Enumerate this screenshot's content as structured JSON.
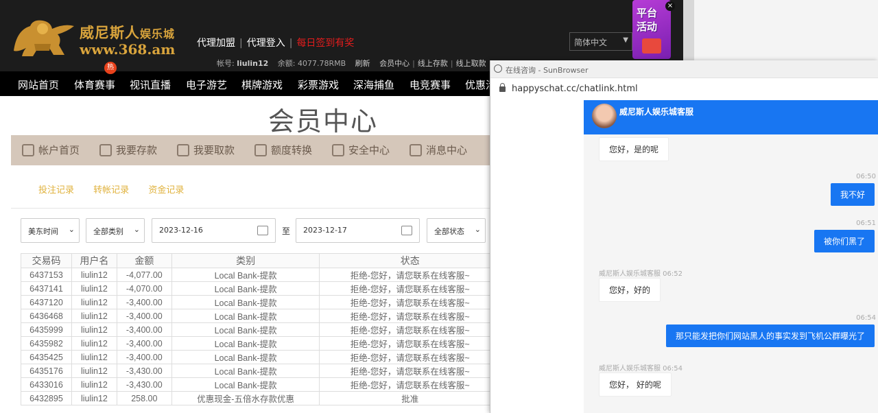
{
  "site": {
    "logo_cn": "威尼斯人",
    "logo_cn_small": "娱乐城",
    "logo_url": "www.368.am",
    "agent_join": "代理加盟",
    "agent_login": "代理登入",
    "daily_signin": "每日签到有奖",
    "language": "简体中文",
    "account_label": "帐号:",
    "account_name": "liulin12",
    "balance_label": "余额:",
    "balance_value": "4077.78RMB",
    "refresh": "刷新",
    "member_center": "会员中心",
    "online_deposit": "线上存款",
    "online_withdraw": "线上取款",
    "promo_line1": "平台",
    "promo_line2": "活动",
    "promo_close": "×",
    "hot_badge": "热",
    "nav": [
      "网站首页",
      "体育赛事",
      "视讯直播",
      "电子游艺",
      "棋牌游戏",
      "彩票游戏",
      "深海捕鱼",
      "电竞赛事",
      "优惠活"
    ],
    "page_title": "会员中心",
    "tabs": [
      "帐户首页",
      "我要存款",
      "我要取款",
      "额度转换",
      "安全中心",
      "消息中心"
    ],
    "sub_links": [
      "投注记录",
      "转帐记录",
      "资金记录"
    ],
    "filters": {
      "timezone": "美东时间",
      "category": "全部类别",
      "date_from": "2023-12-16",
      "to": "至",
      "date_to": "2023-12-17",
      "status": "全部状态"
    },
    "table": {
      "headers": [
        "交易码",
        "用户名",
        "金额",
        "类别",
        "状态"
      ],
      "rows": [
        [
          "6437153",
          "liulin12",
          "-4,077.00",
          "Local Bank-提款",
          "拒绝-您好，请您联系在线客服~"
        ],
        [
          "6437141",
          "liulin12",
          "-4,070.00",
          "Local Bank-提款",
          "拒绝-您好，请您联系在线客服~"
        ],
        [
          "6437120",
          "liulin12",
          "-3,400.00",
          "Local Bank-提款",
          "拒绝-您好，请您联系在线客服~"
        ],
        [
          "6436468",
          "liulin12",
          "-3,400.00",
          "Local Bank-提款",
          "拒绝-您好，请您联系在线客服~"
        ],
        [
          "6435999",
          "liulin12",
          "-3,400.00",
          "Local Bank-提款",
          "拒绝-您好，请您联系在线客服~"
        ],
        [
          "6435982",
          "liulin12",
          "-3,400.00",
          "Local Bank-提款",
          "拒绝-您好，请您联系在线客服~"
        ],
        [
          "6435425",
          "liulin12",
          "-3,400.00",
          "Local Bank-提款",
          "拒绝-您好，请您联系在线客服~"
        ],
        [
          "6435176",
          "liulin12",
          "-3,430.00",
          "Local Bank-提款",
          "拒绝-您好，请您联系在线客服~"
        ],
        [
          "6433016",
          "liulin12",
          "-3,430.00",
          "Local Bank-提款",
          "拒绝-您好，请您联系在线客服~"
        ],
        [
          "6432895",
          "liulin12",
          "258.00",
          "优惠现金-五倍水存款优惠",
          "批准"
        ]
      ]
    }
  },
  "browser": {
    "window_title": "在线咨询 - SunBrowser",
    "url": "happyschat.cc/chatlink.html",
    "agent_name": "威尼斯人娱乐城客服",
    "messages": [
      {
        "from": "agent",
        "text": "您好，是的呢",
        "time": ""
      },
      {
        "from": "user",
        "text": "我不好",
        "time": "06:50"
      },
      {
        "from": "user",
        "text": "被你们黑了",
        "time": "06:51"
      },
      {
        "from": "agent",
        "text": "您好，好的",
        "time": "威尼斯人娱乐城客服 06:52"
      },
      {
        "from": "user",
        "text": "那只能发把你们网站黑人的事实发到飞机公群曝光了",
        "time": "06:54"
      },
      {
        "from": "agent",
        "text": "您好， 好的呢",
        "time": "威尼斯人娱乐城客服 06:54"
      }
    ]
  },
  "colors": {
    "top_bar": "#1c1c1c",
    "gold": "#d9a43c",
    "tab_bar": "#d5c7ba",
    "chat_blue": "#1876f2",
    "alert_red": "#e21c1c"
  }
}
